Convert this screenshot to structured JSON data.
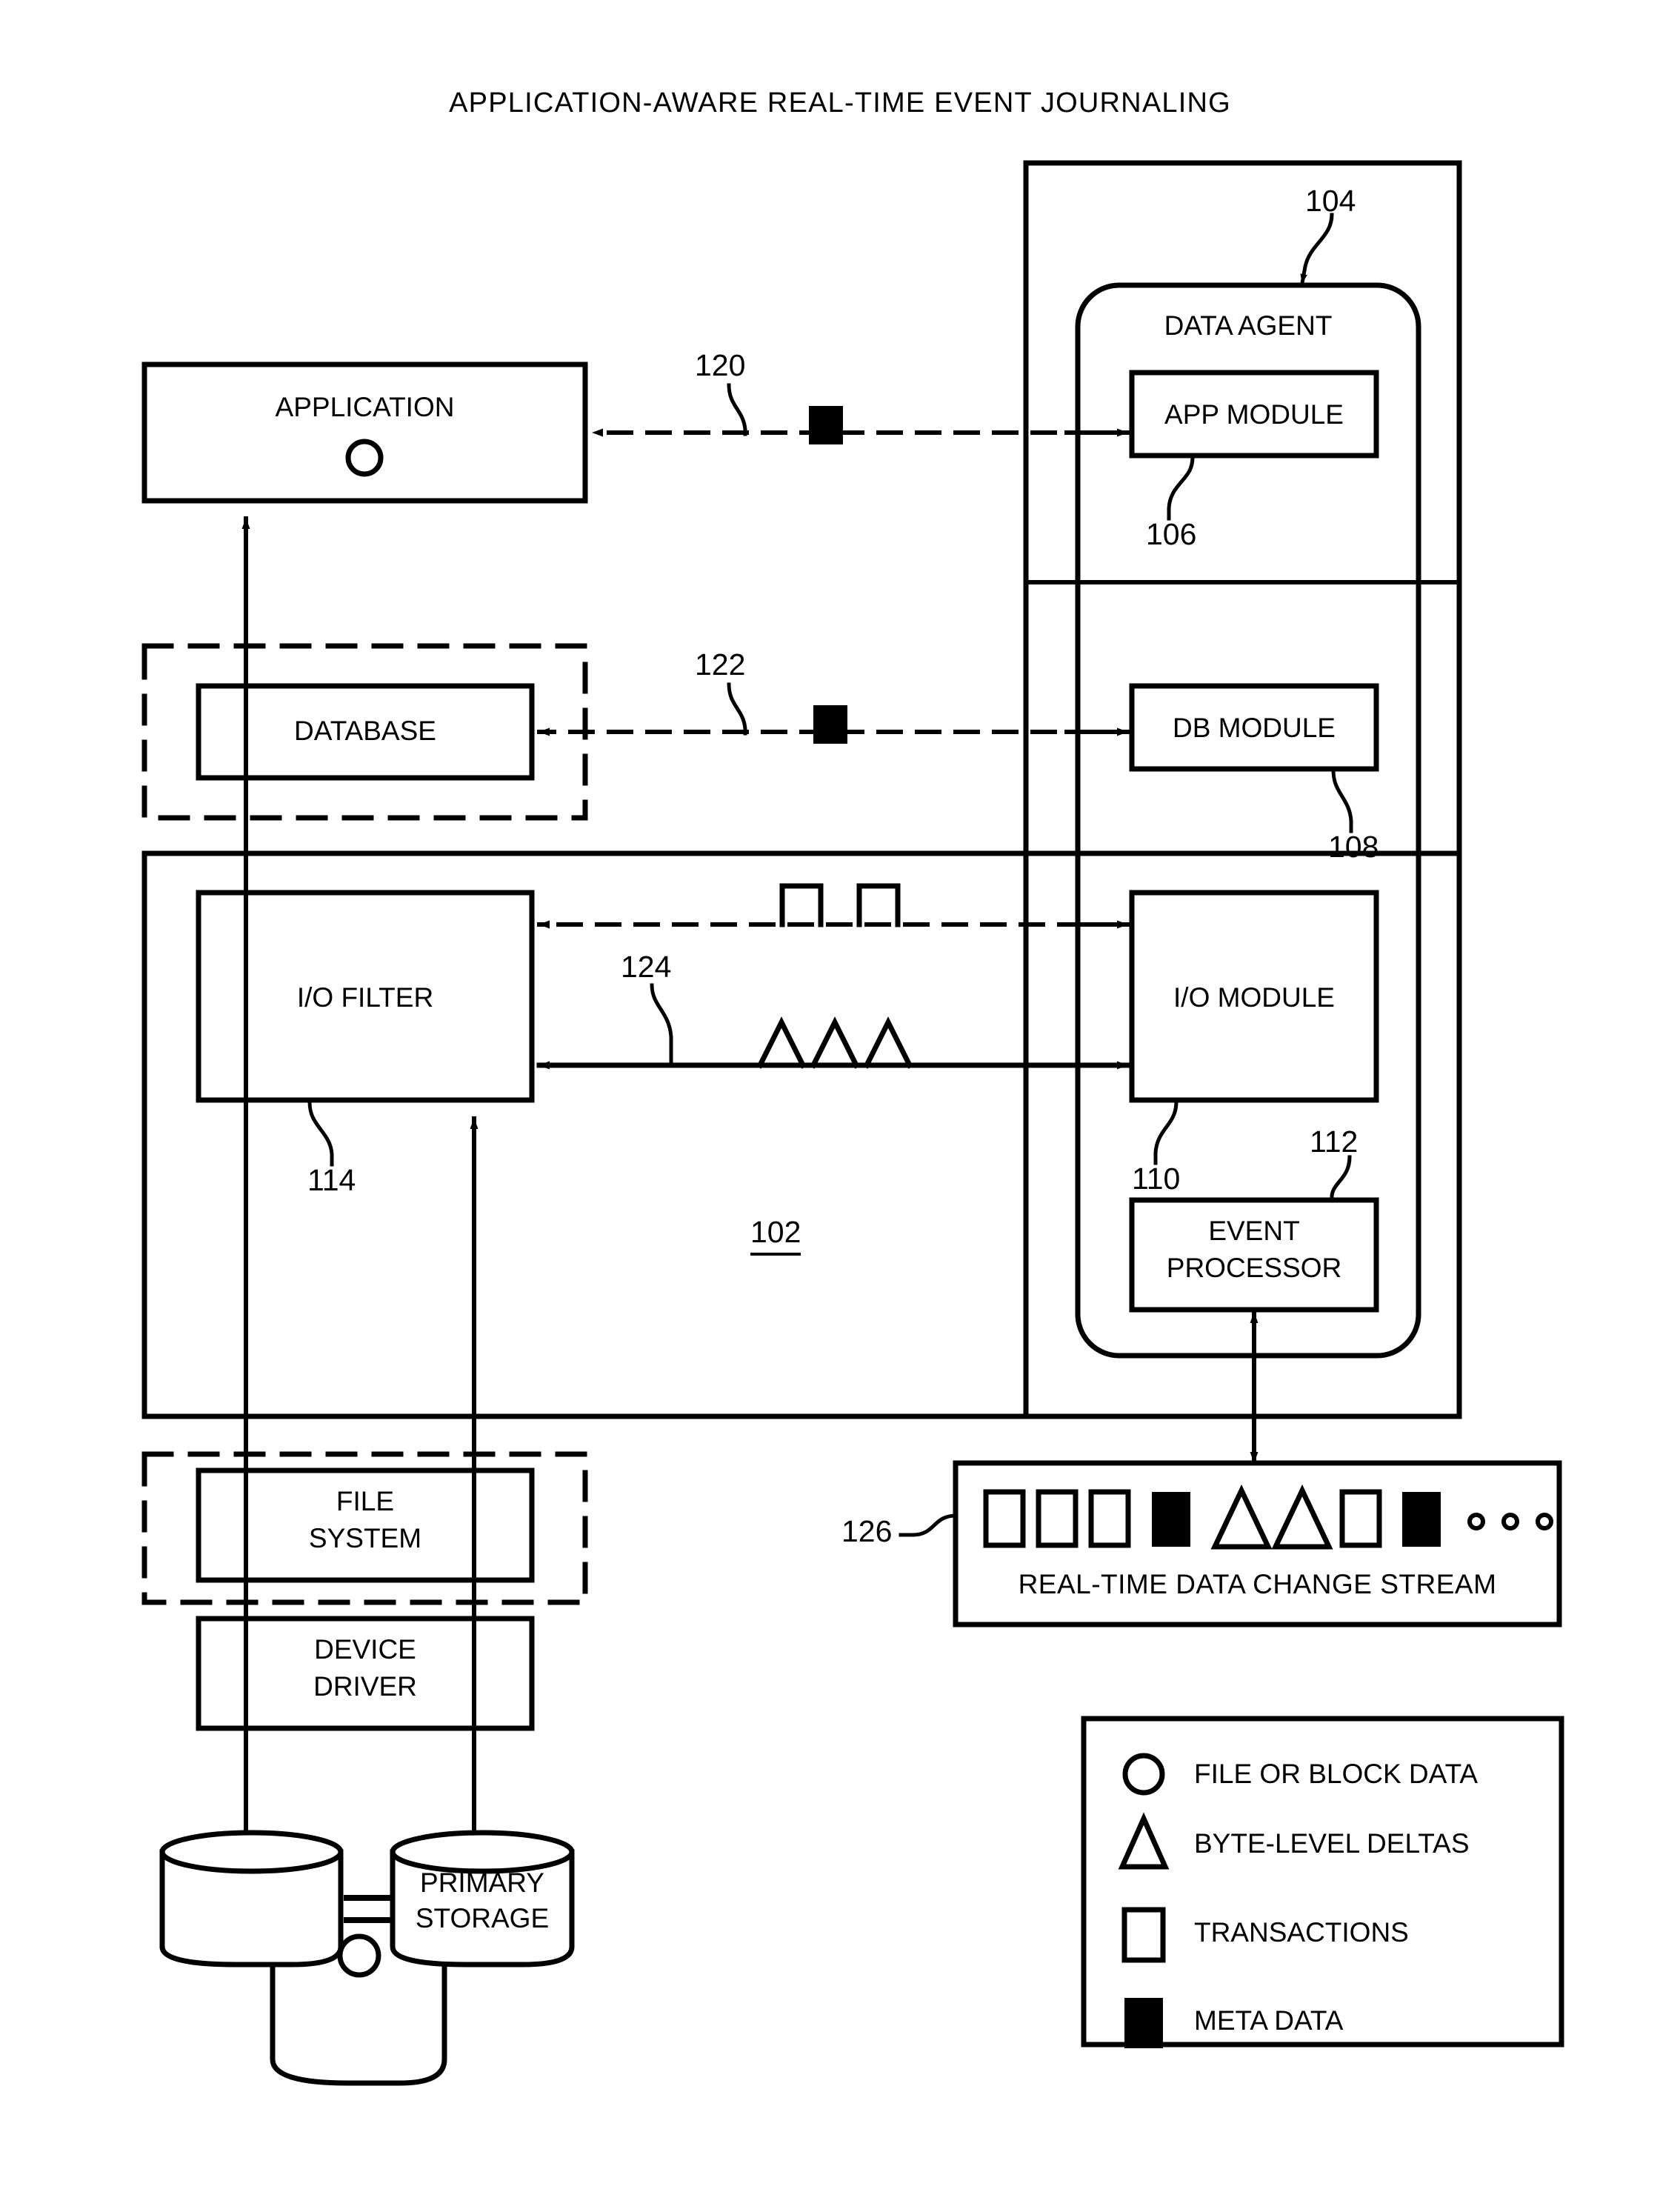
{
  "figure": {
    "title": "APPLICATION-AWARE REAL-TIME EVENT JOURNALING",
    "system_ref": "102"
  },
  "left_stack": {
    "application": {
      "label": "APPLICATION",
      "glyph": "file-or-block-data-circle"
    },
    "database": {
      "label": "DATABASE"
    },
    "io_filter": {
      "label": "I/O FILTER",
      "ref": "114"
    },
    "file_system": {
      "label": "FILE\nSYSTEM",
      "line1": "FILE",
      "line2": "SYSTEM"
    },
    "device_driver": {
      "label": "DEVICE\nDRIVER",
      "line1": "DEVICE",
      "line2": "DRIVER"
    },
    "primary_storage": {
      "line1": "PRIMARY",
      "line2": "STORAGE",
      "equals": "="
    }
  },
  "data_agent": {
    "label": "DATA AGENT",
    "ref": "104",
    "modules": [
      {
        "label": "APP MODULE",
        "ref": "106"
      },
      {
        "label": "DB MODULE",
        "ref": "108"
      },
      {
        "label": "I/O MODULE",
        "ref": "110"
      }
    ],
    "event_processor": {
      "line1": "EVENT",
      "line2": "PROCESSOR",
      "ref": "112"
    }
  },
  "connections": {
    "app_meta_ref": "120",
    "db_meta_ref": "122",
    "io_ref": "124"
  },
  "stream": {
    "ref": "126",
    "label": "REAL-TIME DATA CHANGE STREAM",
    "symbols": [
      "transaction-square",
      "transaction-square",
      "transaction-square",
      "meta-data-filled-square",
      "byte-level-delta-triangle",
      "byte-level-delta-triangle",
      "transaction-square",
      "meta-data-filled-square",
      "ellipsis-dot",
      "ellipsis-dot",
      "ellipsis-dot"
    ]
  },
  "legend": {
    "items": [
      {
        "symbol": "circle",
        "label": "FILE OR BLOCK DATA"
      },
      {
        "symbol": "triangle",
        "label": "BYTE-LEVEL DELTAS"
      },
      {
        "symbol": "square",
        "label": "TRANSACTIONS"
      },
      {
        "symbol": "filled-square",
        "label": "META DATA"
      }
    ]
  },
  "colors": {
    "ink": "#000000",
    "paper": "#ffffff"
  }
}
